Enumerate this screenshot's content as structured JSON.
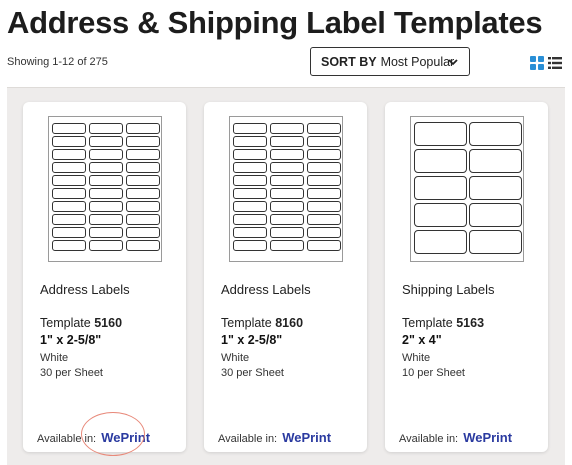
{
  "header": {
    "title": "Address & Shipping Label Templates",
    "showing": "Showing 1-12 of 275",
    "sort_key": "SORT BY",
    "sort_value": "Most Popular"
  },
  "view_toggle": {
    "grid_icon": "grid-view-icon",
    "list_icon": "list-view-icon",
    "active": "grid",
    "accent": "#2a8fd6"
  },
  "cards": [
    {
      "category": "Address Labels",
      "template_prefix": "Template",
      "template_number": "5160",
      "size": "1\" x 2-5/8\"",
      "color": "White",
      "per_sheet": "30 per Sheet",
      "available_label": "Available in:",
      "available_link": "WePrint"
    },
    {
      "category": "Address Labels",
      "template_prefix": "Template",
      "template_number": "8160",
      "size": "1\" x 2-5/8\"",
      "color": "White",
      "per_sheet": "30 per Sheet",
      "available_label": "Available in:",
      "available_link": "WePrint"
    },
    {
      "category": "Shipping Labels",
      "template_prefix": "Template",
      "template_number": "5163",
      "size": "2\" x 4\"",
      "color": "White",
      "per_sheet": "10 per Sheet",
      "available_label": "Available in:",
      "available_link": "WePrint"
    }
  ],
  "colors": {
    "link": "#2a3aa0",
    "highlight": "#e8897a",
    "grid_bg": "#eeeceb"
  }
}
